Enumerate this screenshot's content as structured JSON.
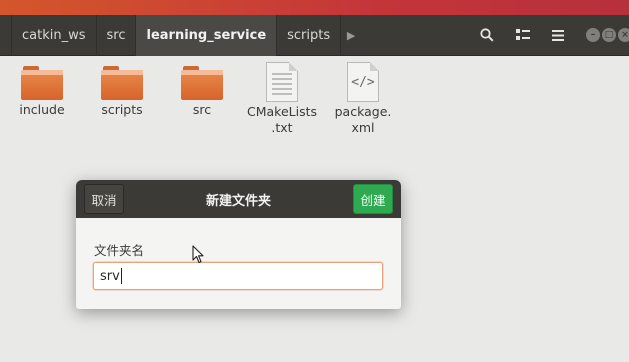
{
  "breadcrumbs": [
    "catkin_ws",
    "src",
    "learning_service",
    "scripts"
  ],
  "active_crumb": "learning_service",
  "header_icons": [
    "search-icon",
    "view-list-icon",
    "menu-icon"
  ],
  "window_controls": [
    "minimize-icon",
    "maximize-icon",
    "close-icon"
  ],
  "files": [
    {
      "name": "include",
      "type": "folder"
    },
    {
      "name": "scripts",
      "type": "folder"
    },
    {
      "name": "src",
      "type": "folder"
    },
    {
      "name": "CMakeLists\n.txt",
      "type": "text-file"
    },
    {
      "name": "package.\nxml",
      "type": "xml-file"
    }
  ],
  "dialog": {
    "title": "新建文件夹",
    "cancel_label": "取消",
    "create_label": "创建",
    "field_label": "文件夹名",
    "field_value": "srv"
  },
  "colors": {
    "accent": "#2eaa50",
    "header_bg": "#3b3a37",
    "folder": "#e07838",
    "input_focus": "#e8a37c"
  }
}
